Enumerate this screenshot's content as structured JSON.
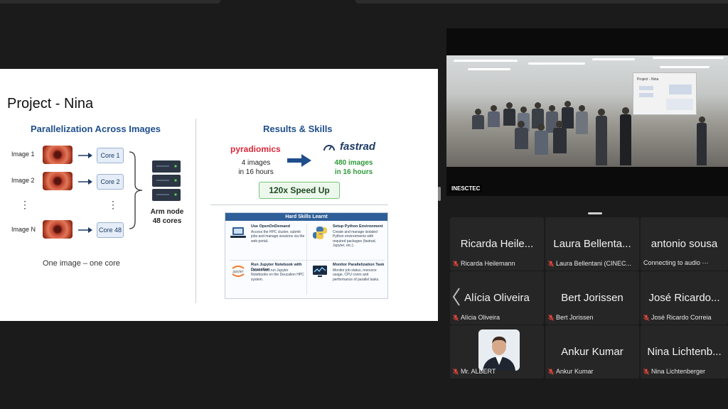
{
  "slide": {
    "title": "Project - Nina",
    "left_heading": "Parallelization Across Images",
    "images": [
      "Image 1",
      "Image 2",
      "Image N"
    ],
    "cores": [
      "Core 1",
      "Core 2",
      "Core 48"
    ],
    "vdots": "⋮",
    "arm_node": "Arm node",
    "arm_cores": "48 cores",
    "one_core": "One image – one core",
    "right_heading": "Results & Skills",
    "pyradiomics": "pyradiomics",
    "pyradiomics_result_1": "4 images",
    "pyradiomics_result_2": "in 16 hours",
    "fastrad": "fastrad",
    "fastrad_result_1": "480 images",
    "fastrad_result_2": "in 16 hours",
    "speedup": "120x Speed Up",
    "skills_heading": "Hard Skills Learnt",
    "skills": [
      {
        "title": "Use OpenOnDemand",
        "desc": "Access the HPC cluster, submit jobs and manage sessions via the web portal."
      },
      {
        "title": "Setup Python Environment",
        "desc": "Create and manage isolated Python environments with required packages (fastrad, Jupyter, etc.)."
      },
      {
        "title": "Run Jupyter Notebook with Deucalion",
        "desc": "Launch and run Jupyter Notebooks on the Deucalion HPC system."
      },
      {
        "title": "Monitor Parallelization Task",
        "desc": "Monitor job status, resource usage, CPU cores and performance of parallel tasks."
      }
    ],
    "jupyter_logo": "jupyter",
    "room_slide_title": "Project - Nina"
  },
  "video": {
    "label": "INESCTEC"
  },
  "participants": [
    {
      "big": "Ricarda Heile...",
      "name": "Ricarda Heilemann",
      "muted": true
    },
    {
      "big": "Laura Bellenta...",
      "name": "Laura Bellentani (CINEC...",
      "muted": true
    },
    {
      "big": "antonio sousa",
      "name": "Connecting to audio ⋯",
      "muted": false
    },
    {
      "big": "Alícia Oliveira",
      "name": "Alícia Oliveira",
      "muted": true
    },
    {
      "big": "Bert Jorissen",
      "name": "Bert Jorissen",
      "muted": true
    },
    {
      "big": "José Ricardo...",
      "name": "José Ricardo Correia",
      "muted": true
    },
    {
      "big": "",
      "name": "Mr. ALBERT",
      "muted": true,
      "has_photo": true
    },
    {
      "big": "Ankur Kumar",
      "name": "Ankur Kumar",
      "muted": true
    },
    {
      "big": "Nina Lichtenb...",
      "name": "Nina Lichtenberger",
      "muted": true
    }
  ],
  "colors": {
    "heading_blue": "#1f4e8c",
    "pyradiomics_red": "#d9283a",
    "fastrad_green": "#2e9a3a",
    "mute_red": "#e5483b",
    "background": "#1b1b1b"
  }
}
